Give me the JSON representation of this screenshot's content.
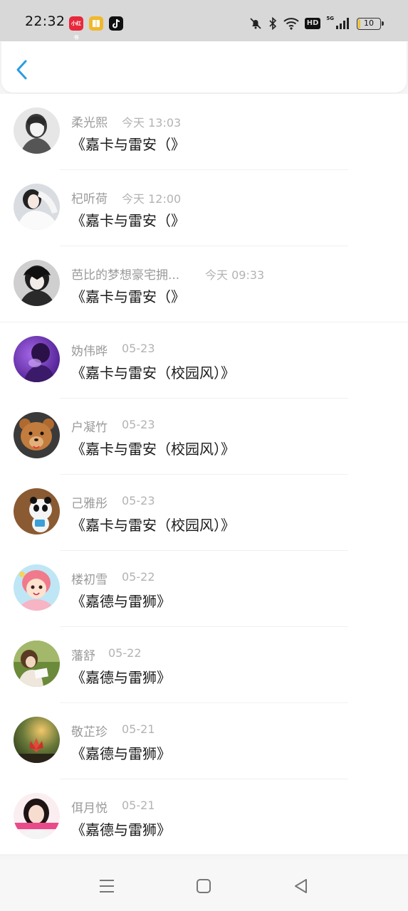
{
  "status_bar": {
    "time": "22:32",
    "app_icons": [
      {
        "name": "xiaohongshu-app-icon",
        "color": "#e8283b",
        "text": "小红书"
      },
      {
        "name": "reader-app-icon",
        "color": "#f1b829",
        "text": ""
      },
      {
        "name": "douyin-app-icon",
        "color": "#111111",
        "text": ""
      }
    ],
    "network_hd": "HD",
    "network_gen": "5G",
    "battery_level": "10"
  },
  "header": {
    "back_icon": "chevron-left-icon",
    "accent_color": "#2b9be4"
  },
  "items": [
    {
      "name": "柔光熙",
      "time": "今天 13:03",
      "title": "《嘉卡与雷安（》"
    },
    {
      "name": "杞听荷",
      "time": "今天 12:00",
      "title": "《嘉卡与雷安（》"
    },
    {
      "name": "芭比的梦想豪宅拥...",
      "time": "今天 09:33",
      "title": "《嘉卡与雷安（》"
    },
    {
      "name": "妫伟晔",
      "time": "05-23",
      "title": "《嘉卡与雷安（校园风）》"
    },
    {
      "name": "户凝竹",
      "time": "05-23",
      "title": "《嘉卡与雷安（校园风）》"
    },
    {
      "name": "己雅彤",
      "time": "05-23",
      "title": "《嘉卡与雷安（校园风）》"
    },
    {
      "name": "楼初雪",
      "time": "05-22",
      "title": "《嘉德与雷狮》"
    },
    {
      "name": "藩舒",
      "time": "05-22",
      "title": "《嘉德与雷狮》"
    },
    {
      "name": "敬芷珍",
      "time": "05-21",
      "title": "《嘉德与雷狮》"
    },
    {
      "name": "佴月悦",
      "time": "05-21",
      "title": "《嘉德与雷狮》"
    }
  ],
  "nav_bar": {
    "buttons": [
      "menu-icon",
      "home-square-icon",
      "back-triangle-icon"
    ]
  }
}
